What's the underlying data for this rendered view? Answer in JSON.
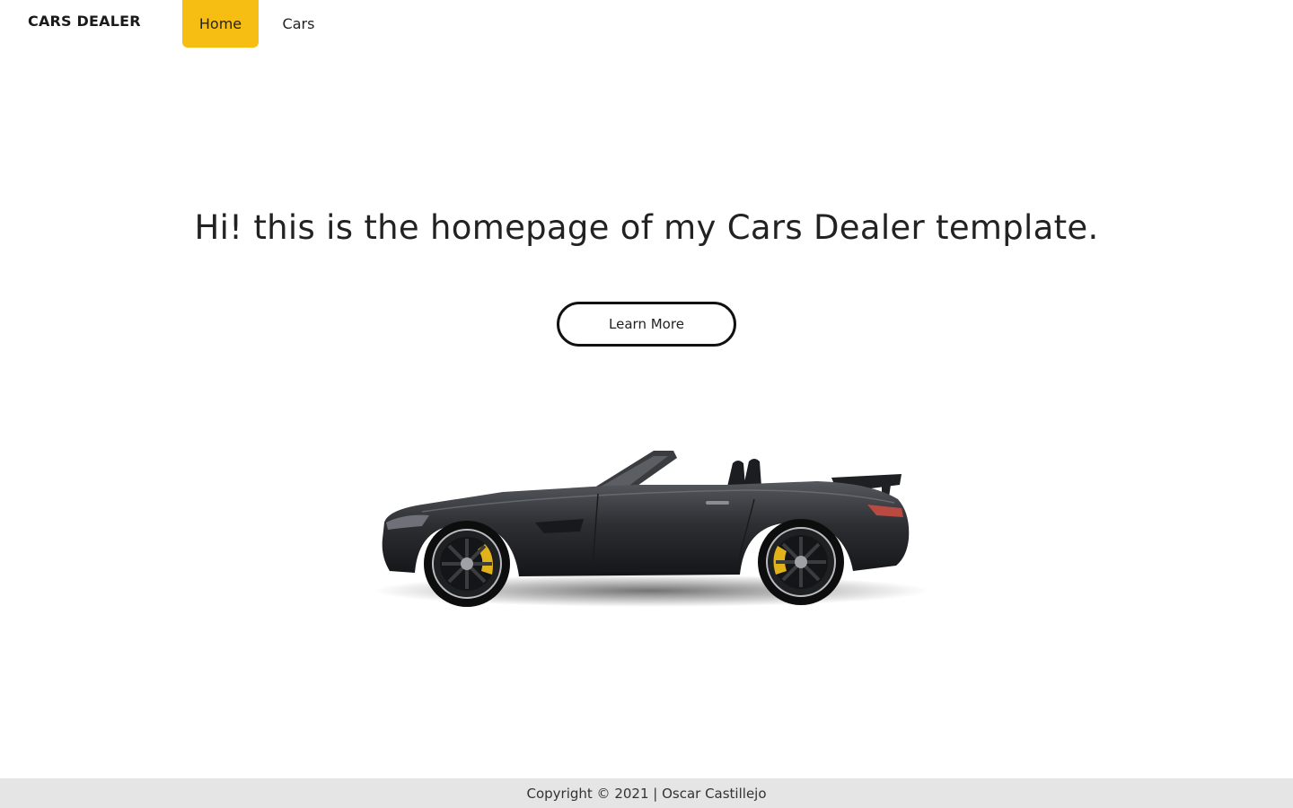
{
  "nav": {
    "brand": "CARS DEALER",
    "links": [
      {
        "label": "Home",
        "active": true
      },
      {
        "label": "Cars",
        "active": false
      }
    ],
    "active_color": "#f6be12"
  },
  "hero": {
    "title": "Hi! this is the homepage of my Cars Dealer template.",
    "button_label": "Learn More"
  },
  "image": {
    "icon": "car-convertible"
  },
  "footer": {
    "text": "Copyright © 2021 | Oscar Castillejo"
  }
}
